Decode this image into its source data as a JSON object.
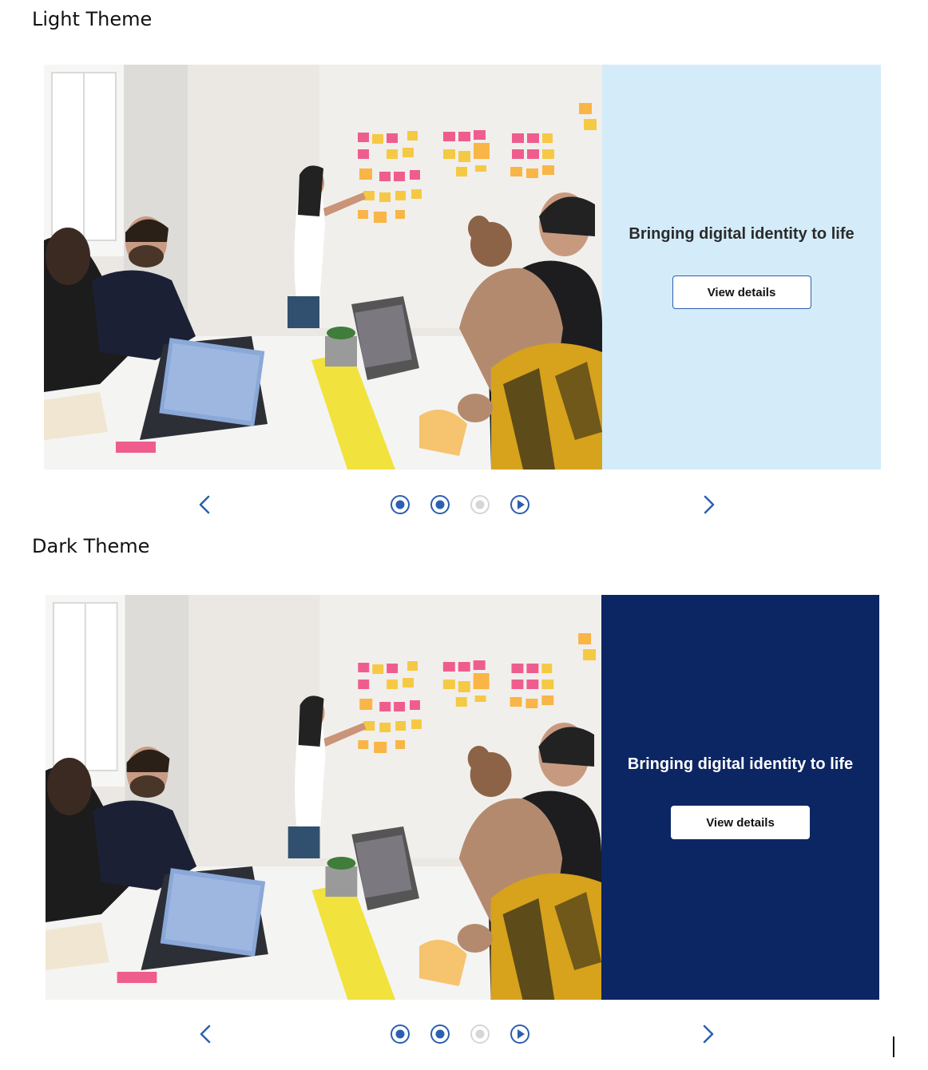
{
  "sections": {
    "light": {
      "heading": "Light Theme"
    },
    "dark": {
      "heading": "Dark Theme"
    }
  },
  "panel": {
    "title": "Bringing digital identity to life",
    "button_label": "View details"
  },
  "controls": {
    "prev_icon": "chevron-left-icon",
    "next_icon": "chevron-right-icon",
    "dots": [
      {
        "state": "active",
        "icon": "radio-filled-icon"
      },
      {
        "state": "active",
        "icon": "radio-filled-icon"
      },
      {
        "state": "inactive",
        "icon": "radio-disabled-icon"
      },
      {
        "state": "play",
        "icon": "play-icon"
      }
    ]
  },
  "colors": {
    "accent": "#2c5fb0",
    "light_panel": "#d4ecfa",
    "dark_panel": "#0c2663",
    "inactive_dot": "#d6d6d6"
  }
}
